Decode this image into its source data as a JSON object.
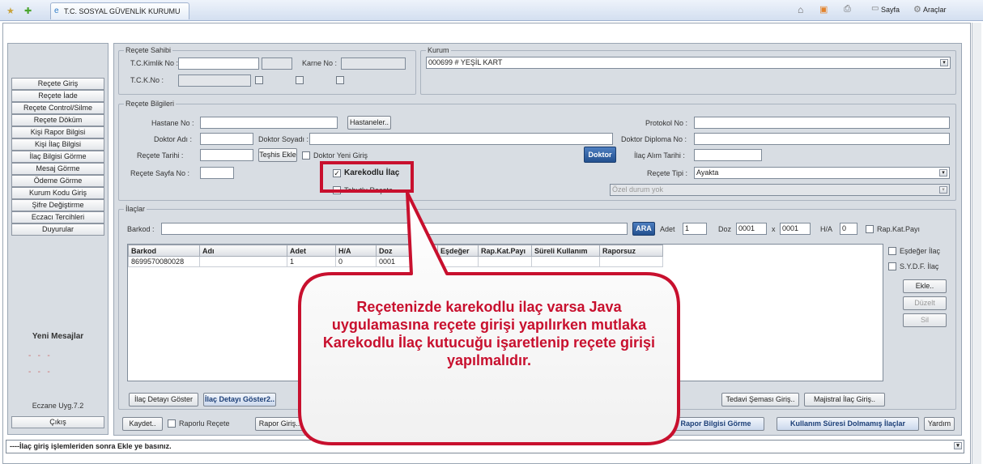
{
  "browser": {
    "tab_title": "T.C. SOSYAL GÜVENLİK KURUMU",
    "toolbar": {
      "page": "Sayfa",
      "tools": "Araçlar"
    }
  },
  "sidebar": {
    "items": [
      "Reçete Giriş",
      "Reçete İade",
      "Reçete Control/Silme",
      "Reçete Döküm",
      "Kişi Rapor Bilgisi",
      "Kişi İlaç Bilgisi",
      "İlaç Bilgisi Görme",
      "Mesaj Görme",
      "Ödeme Görme",
      "Kurum Kodu Giriş",
      "Şifre Değiştirme",
      "Eczacı Tercihleri",
      "Duyurular"
    ],
    "new_messages": "Yeni Mesajlar",
    "dashes": [
      "-   -   -",
      "-   -   -"
    ],
    "version": "Eczane Uyg.7.2",
    "exit": "Çıkış"
  },
  "recete_sahibi": {
    "legend": "Reçete Sahibi",
    "tc_label": "T.C.Kimlik No :",
    "karne_label": "Karne No :",
    "tck_label": "T.C.K.No :"
  },
  "kurum": {
    "legend": "Kurum",
    "value": "000699 # YEŞİL KART"
  },
  "recete_bilgileri": {
    "legend": "Reçete Bilgileri",
    "hastane_no": "Hastane No :",
    "hastaneler": "Hastaneler..",
    "doktor_adi": "Doktor Adı :",
    "doktor_soyadi": "Doktor Soyadı :",
    "recete_tarihi": "Reçete Tarihi :",
    "teshis_ekle": "Teşhis Ekle",
    "doktor_yeni_giris": "Doktor Yeni Giriş",
    "doktor": "Doktor",
    "recete_sayfa_no": "Reçete Sayfa No :",
    "karekodlu_ilac": "Karekodlu İlaç",
    "tabutlu_recete": "Tabutlu Reçete",
    "protokol_no": "Protokol No :",
    "doktor_diploma_no": "Doktor Diploma No :",
    "ilac_alim_tarihi": "İlaç Alım Tarihi :",
    "recete_tipi": "Reçete Tipi :",
    "recete_tipi_value": "Ayakta",
    "ozel_durum": "Özel durum yok"
  },
  "ilaclar": {
    "legend": "İlaçlar",
    "barkod_label": "Barkod :",
    "ara": "ARA",
    "adet_label": "Adet",
    "adet_value": "1",
    "doz_label": "Doz",
    "doz_value": "0001",
    "x": "x",
    "doz2_value": "0001",
    "ha_label": "H/A",
    "ha_value": "0",
    "rap_kat_payi": "Rap.Kat.Payı",
    "columns": [
      "Barkod",
      "Adı",
      "Adet",
      "H/A",
      "Doz",
      "Eşdeğer",
      "Rap.Kat.Payı",
      "Süreli Kullanım",
      "Raporsuz"
    ],
    "rows": [
      [
        "8699570080028",
        "",
        "1",
        "0",
        "0001",
        "",
        "",
        "",
        ""
      ]
    ],
    "esdeger_ilac": "Eşdeğer İlaç",
    "sydf_ilac": "S.Y.D.F. İlaç",
    "ekle": "Ekle..",
    "duzelt": "Düzelt",
    "sil": "Sil",
    "ilac_detay_goster": "İlaç Detayı Göster",
    "ilac_detayi_goster2": "İlaç Detayı Göster2..",
    "tedavi_semasi": "Tedavi Şeması Giriş..",
    "majistral": "Majistral İlaç Giriş.."
  },
  "bottom": {
    "kaydet": "Kaydet..",
    "raporlu_recete": "Raporlu Reçete",
    "rapor_giris": "Rapor Giriş..",
    "rapor_bilgisi_gorme": "Rapor Bilgisi Görme",
    "kullanim_suresi": "Kullanım Süresi Dolmamış İlaçlar",
    "yardim": "Yardım"
  },
  "status": {
    "text": "----İlaç giriş işlemleriden sonra Ekle ye basınız."
  },
  "callout": {
    "text": "Reçetenizde karekodlu ilaç varsa Java uygulamasına reçete girişi yapılırken mutlaka Karekodlu İlaç kutucuğu işaretlenip reçete girişi yapılmalıdır."
  },
  "colors": {
    "callout_red": "#c8102e",
    "app_bg": "#d8dde3",
    "button_blue": "#2b5797"
  }
}
